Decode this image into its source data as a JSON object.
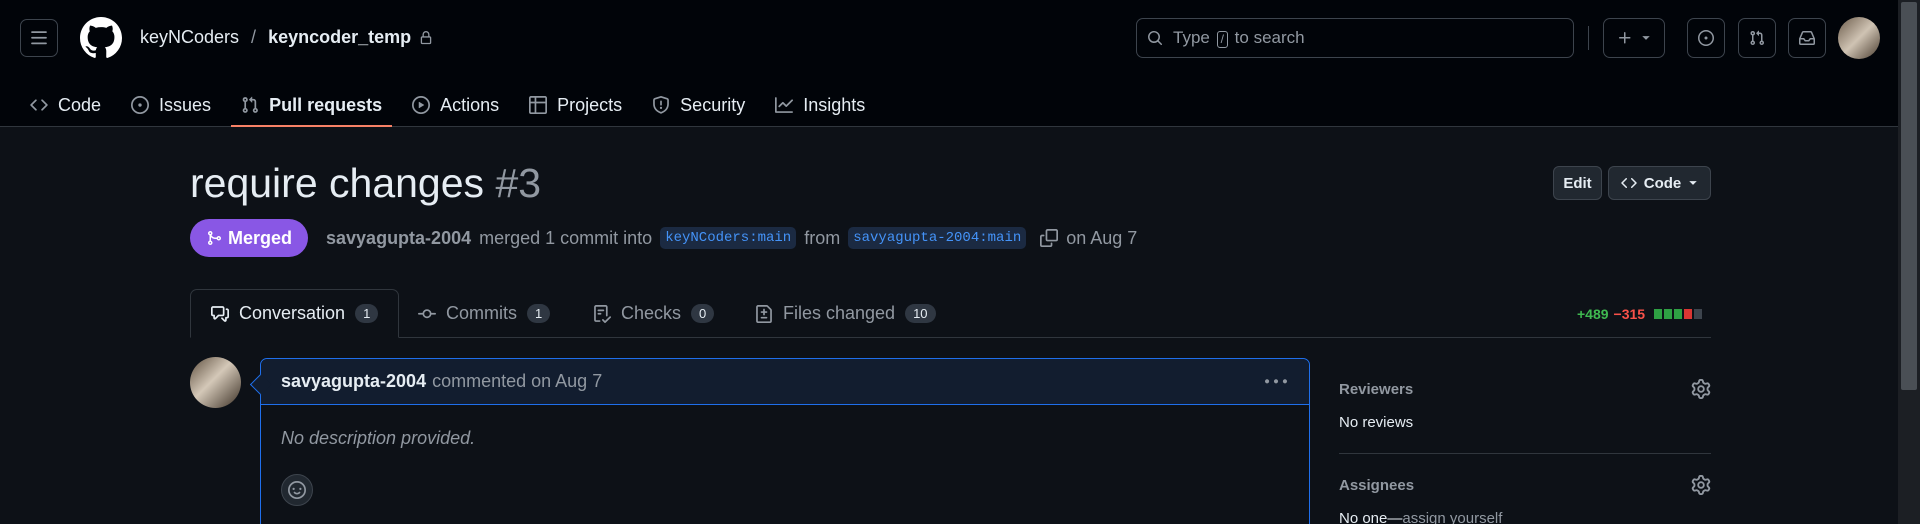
{
  "header": {
    "owner": "keyNCoders",
    "separator": "/",
    "repo": "keyncoder_temp",
    "search_prefix": "Type",
    "search_key": "/",
    "search_suffix": "to search"
  },
  "repo_tabs": [
    {
      "label": "Code",
      "icon": "code-icon"
    },
    {
      "label": "Issues",
      "icon": "issue-icon"
    },
    {
      "label": "Pull requests",
      "icon": "pull-request-icon",
      "active": true
    },
    {
      "label": "Actions",
      "icon": "play-icon"
    },
    {
      "label": "Projects",
      "icon": "table-icon"
    },
    {
      "label": "Security",
      "icon": "shield-icon"
    },
    {
      "label": "Insights",
      "icon": "graph-icon"
    }
  ],
  "pr": {
    "title": "require changes",
    "number": "#3",
    "edit_label": "Edit",
    "code_label": "Code",
    "status": "Merged",
    "author": "savyagupta-2004",
    "merged_text": "merged 1 commit into",
    "base_branch": "keyNCoders:main",
    "from_text": "from",
    "head_branch": "savyagupta-2004:main",
    "date_text": "on Aug 7"
  },
  "pr_tabs": [
    {
      "label": "Conversation",
      "count": "1",
      "icon": "comment-icon"
    },
    {
      "label": "Commits",
      "count": "1",
      "icon": "commit-icon"
    },
    {
      "label": "Checks",
      "count": "0",
      "icon": "checklist-icon"
    },
    {
      "label": "Files changed",
      "count": "10",
      "icon": "file-diff-icon"
    }
  ],
  "diffstat": {
    "additions": "+489",
    "deletions": "−315"
  },
  "comment": {
    "author": "savyagupta-2004",
    "action": "commented on Aug 7",
    "body": "No description provided."
  },
  "sidebar": {
    "reviewers_title": "Reviewers",
    "reviewers_value": "No reviews",
    "assignees_title": "Assignees",
    "assignees_value": "No one—",
    "assignees_link": "assign yourself"
  },
  "colors": {
    "accent_merged": "#8957e5",
    "active_tab_underline": "#f78166",
    "link_blue": "#4493f8",
    "addition_green": "#3fb950",
    "deletion_red": "#f85149"
  }
}
